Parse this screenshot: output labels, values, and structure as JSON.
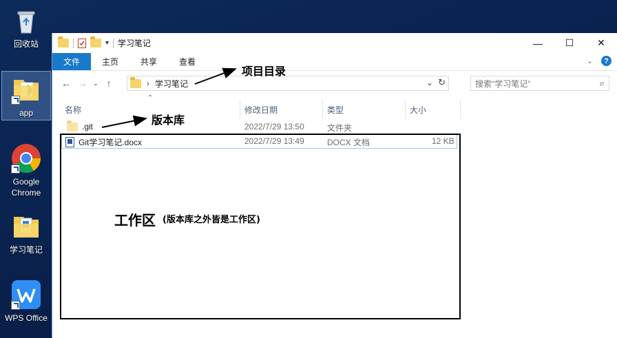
{
  "desktop": {
    "icons": [
      {
        "label": "回收站"
      },
      {
        "label": "app"
      },
      {
        "label": "Google Chrome"
      },
      {
        "label": "学习笔记"
      },
      {
        "label": "WPS Office"
      }
    ]
  },
  "window": {
    "title": "学习笔记",
    "ribbon_tabs": [
      "文件",
      "主页",
      "共享",
      "查看"
    ],
    "breadcrumb": "学习笔记",
    "search_placeholder": "搜索\"学习笔记\"",
    "columns": [
      "名称",
      "修改日期",
      "类型",
      "大小"
    ],
    "files": [
      {
        "name": ".git",
        "date": "2022/7/29 13:50",
        "type": "文件夹",
        "size": ""
      },
      {
        "name": "Git学习笔记.docx",
        "date": "2022/7/29 13:49",
        "type": "DOCX 文档",
        "size": "12 KB"
      }
    ]
  },
  "annotations": {
    "project_dir": "项目目录",
    "repo": "版本库",
    "workspace": "工作区",
    "workspace_note": "(版本库之外皆是工作区)"
  }
}
